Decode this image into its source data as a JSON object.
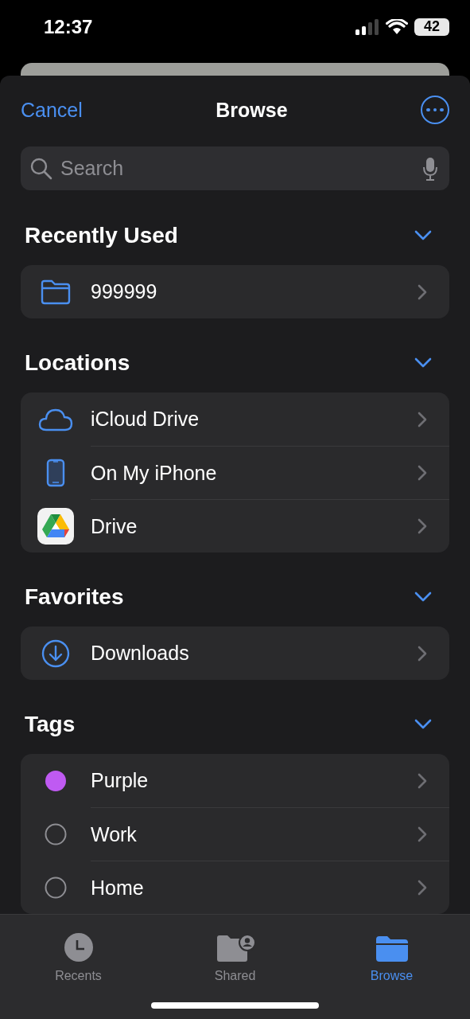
{
  "status_bar": {
    "time": "12:37",
    "battery": "42"
  },
  "nav": {
    "cancel": "Cancel",
    "title": "Browse"
  },
  "search": {
    "placeholder": "Search"
  },
  "sections": [
    {
      "title": "Recently Used",
      "expanded": true,
      "items": [
        {
          "kind": "folder",
          "label": "999999"
        }
      ]
    },
    {
      "title": "Locations",
      "expanded": true,
      "items": [
        {
          "kind": "cloud",
          "label": "iCloud Drive"
        },
        {
          "kind": "phone",
          "label": "On My iPhone"
        },
        {
          "kind": "drive",
          "label": "Drive"
        }
      ]
    },
    {
      "title": "Favorites",
      "expanded": true,
      "items": [
        {
          "kind": "download",
          "label": "Downloads"
        }
      ]
    },
    {
      "title": "Tags",
      "expanded": true,
      "items": [
        {
          "kind": "tag",
          "label": "Purple",
          "color": "#bf5af2"
        },
        {
          "kind": "tag",
          "label": "Work"
        },
        {
          "kind": "tag",
          "label": "Home"
        }
      ]
    }
  ],
  "tabs": [
    {
      "kind": "recents",
      "label": "Recents",
      "selected": false
    },
    {
      "kind": "shared",
      "label": "Shared",
      "selected": false
    },
    {
      "kind": "browse",
      "label": "Browse",
      "selected": true
    }
  ]
}
